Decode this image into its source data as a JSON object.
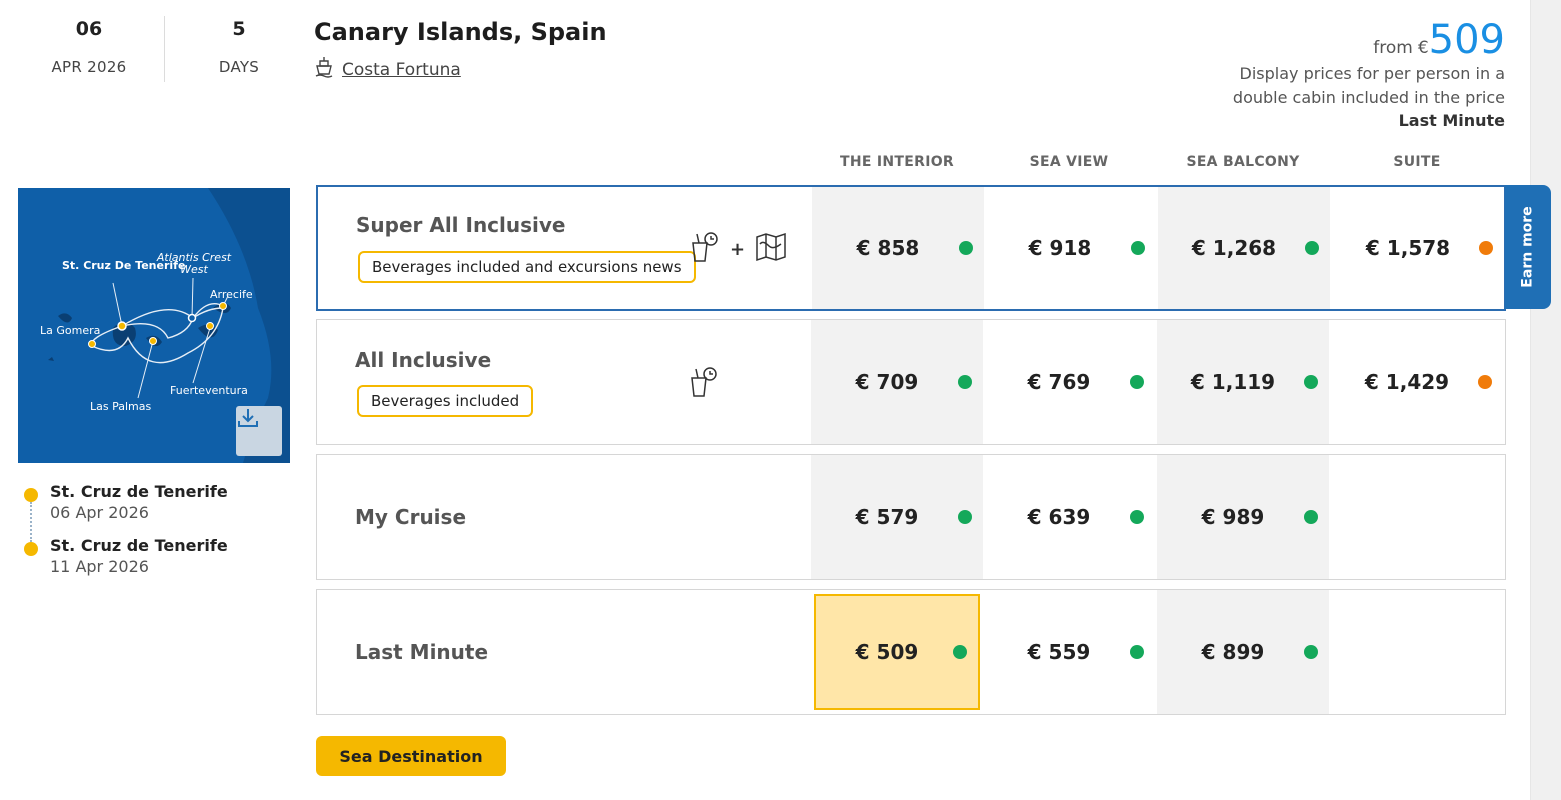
{
  "header": {
    "date_day": "06",
    "date_month_year": "APR 2026",
    "days_count": "5",
    "days_label": "DAYS",
    "title": "Canary Islands, Spain",
    "ship_name": "Costa Fortuna",
    "ship_icon": "ship-icon"
  },
  "price_summary": {
    "from_label": "from",
    "currency": "€",
    "amount": "509",
    "note_line1": "Display prices for per person in a",
    "note_line2": "double cabin included in the price",
    "fare_name": "Last Minute"
  },
  "columns": [
    "THE INTERIOR",
    "SEA VIEW",
    "SEA BALCONY",
    "SUITE"
  ],
  "map": {
    "labels": {
      "st_cruz": "St. Cruz De Tenerife",
      "atlantis": "Atlantis Crest West",
      "arrecife": "Arrecife",
      "la_gomera": "La Gomera",
      "fuerteventura": "Fuerteventura",
      "las_palmas": "Las Palmas"
    },
    "download_icon": "download-icon",
    "sea_color": "#0f5fa8"
  },
  "itinerary": [
    {
      "port": "St. Cruz de Tenerife",
      "date": "06 Apr 2026"
    },
    {
      "port": "St. Cruz de Tenerife",
      "date": "11 Apr 2026"
    }
  ],
  "fares": [
    {
      "name": "Super All Inclusive",
      "badge": "Beverages included and excursions news",
      "icons": [
        "drinks-icon",
        "map-icon"
      ],
      "plus": "+",
      "prices": [
        {
          "value": "€ 858",
          "availability": "green"
        },
        {
          "value": "€ 918",
          "availability": "green"
        },
        {
          "value": "€ 1,268",
          "availability": "green"
        },
        {
          "value": "€ 1,578",
          "availability": "orange"
        }
      ]
    },
    {
      "name": "All Inclusive",
      "badge": "Beverages included",
      "icons": [
        "drinks-icon"
      ],
      "prices": [
        {
          "value": "€ 709",
          "availability": "green"
        },
        {
          "value": "€ 769",
          "availability": "green"
        },
        {
          "value": "€ 1,119",
          "availability": "green"
        },
        {
          "value": "€ 1,429",
          "availability": "orange"
        }
      ]
    },
    {
      "name": "My Cruise",
      "prices": [
        {
          "value": "€ 579",
          "availability": "green"
        },
        {
          "value": "€ 639",
          "availability": "green"
        },
        {
          "value": "€ 989",
          "availability": "green"
        }
      ]
    },
    {
      "name": "Last Minute",
      "prices": [
        {
          "value": "€ 509",
          "availability": "green",
          "selected": true
        },
        {
          "value": "€ 559",
          "availability": "green"
        },
        {
          "value": "€ 899",
          "availability": "green"
        }
      ]
    }
  ],
  "earn_more": "Earn more",
  "sea_destination_button": "Sea Destination",
  "colors": {
    "accent_blue": "#1a8fe3",
    "brand_yellow": "#f5b800",
    "available_green": "#14a85a",
    "limited_orange": "#f07b0a",
    "selected_border": "#2b6cb0"
  }
}
